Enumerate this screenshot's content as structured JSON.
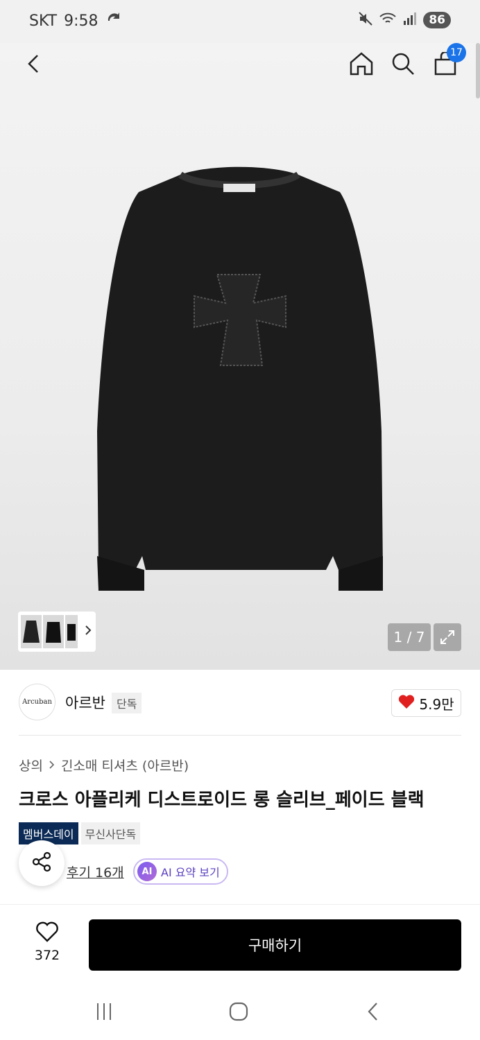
{
  "status_bar": {
    "carrier": "SKT",
    "time": "9:58",
    "battery": "86"
  },
  "nav": {
    "cart_count": "17"
  },
  "gallery": {
    "pager": "1 / 7"
  },
  "brand": {
    "logo_text": "Arcuban",
    "name": "아르반",
    "tag": "단독",
    "likes": "5.9만"
  },
  "breadcrumb": {
    "category": "상의",
    "subcategory": "긴소매 티셔츠 (아르반)"
  },
  "product": {
    "title": "크로스 아플리케 디스트로이드 롱 슬리브_페이드 블랙",
    "tags": [
      "멤버스데이",
      "무신사단독"
    ],
    "review_link": "후기 16개",
    "ai_label": "AI",
    "ai_button": "AI 요약 보기"
  },
  "bottom_bar": {
    "wish_count": "372",
    "buy_label": "구매하기"
  },
  "colors": {
    "accent_blue": "#1a73e8",
    "heart_red": "#e0201f",
    "tag_navy": "#0b2a55",
    "ai_purple": "#5a3fc0"
  },
  "icons": [
    "back-icon",
    "home-icon",
    "search-icon",
    "cart-icon",
    "chevron-right-icon",
    "expand-icon",
    "heart-icon",
    "share-icon",
    "recents-icon",
    "home-button-icon",
    "back-nav-icon"
  ]
}
